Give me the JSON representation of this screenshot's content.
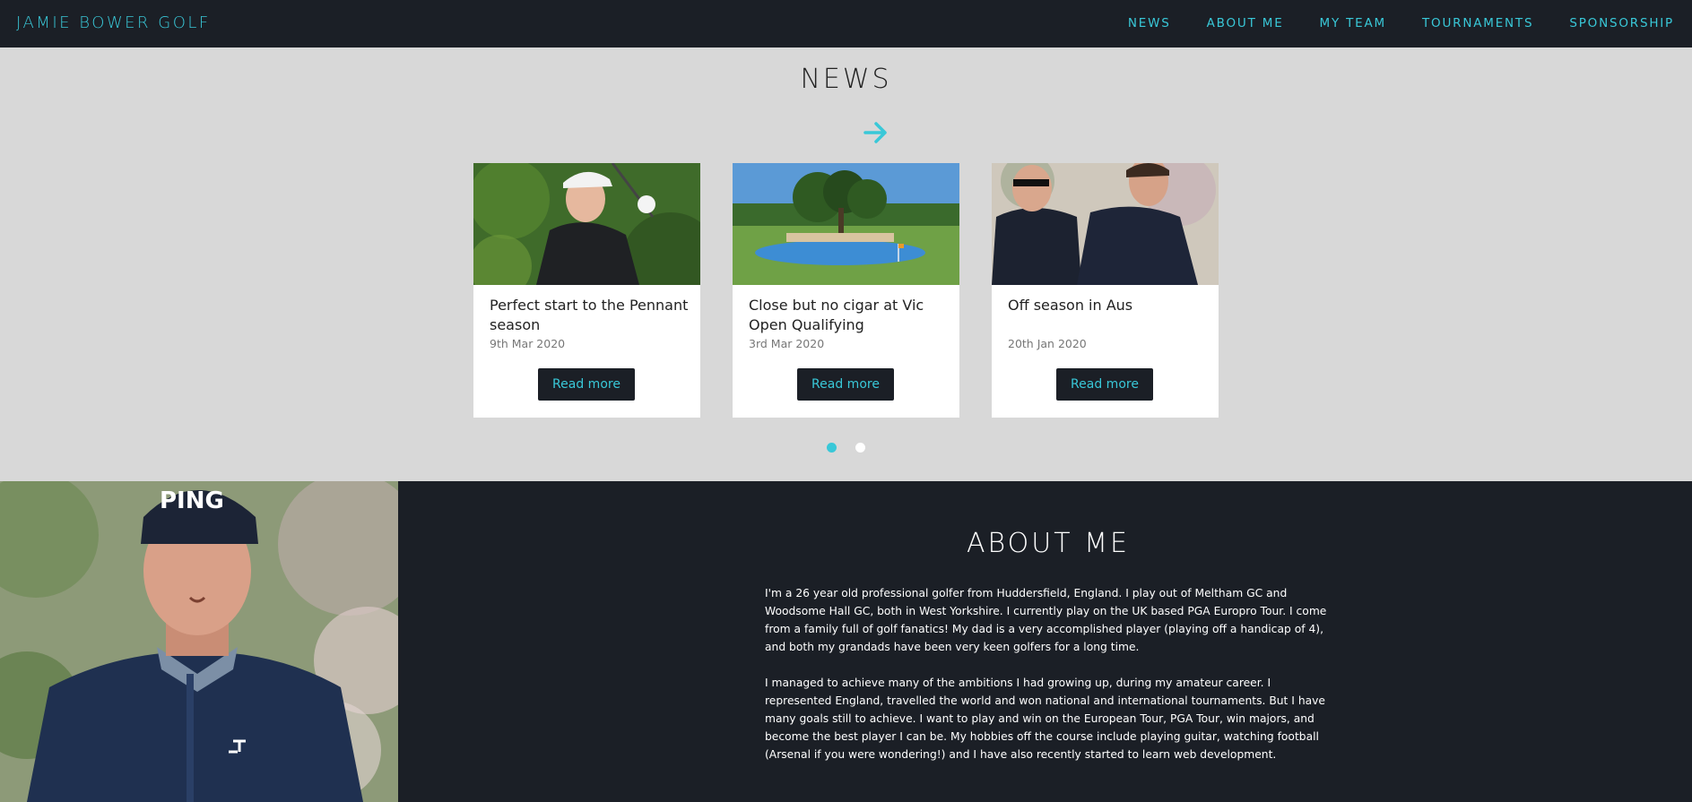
{
  "header": {
    "brand": "JAMIE BOWER GOLF",
    "nav": [
      "NEWS",
      "ABOUT ME",
      "MY TEAM",
      "TOURNAMENTS",
      "SPONSORSHIP"
    ]
  },
  "news": {
    "title": "NEWS",
    "next_icon": "arrow-right-icon",
    "cards": [
      {
        "title": "Perfect start to the Pennant season",
        "date": "9th Mar 2020",
        "button": "Read more"
      },
      {
        "title": "Close but no cigar at Vic Open Qualifying",
        "date": "3rd Mar 2020",
        "button": "Read more"
      },
      {
        "title": "Off season in Aus",
        "date": "20th Jan 2020",
        "button": "Read more"
      }
    ],
    "pagination": {
      "pages": 2,
      "active": 1
    }
  },
  "about": {
    "title": "ABOUT ME",
    "paragraphs": [
      "I'm a 26 year old professional golfer from Huddersfield, England. I play out of Meltham GC and Woodsome Hall GC, both in West Yorkshire. I currently play on the UK based PGA Europro Tour. I come from a family full of golf fanatics! My dad is a very accomplished player (playing off a handicap of 4), and both my grandads have been very keen golfers for a long time.",
      "I managed to achieve many of the ambitions I had growing up, during my amateur career. I represented England, travelled the world and won national and international tournaments. But I have many goals still to achieve. I want to play and win on the European Tour, PGA Tour, win majors, and become the best player I can be. My hobbies off the course include playing guitar, watching football (Arsenal if you were wondering!) and I have also recently started to learn web development."
    ]
  },
  "colors": {
    "accent": "#39c8d8",
    "dark": "#1b1f26",
    "section_bg": "#d8d8d8"
  }
}
